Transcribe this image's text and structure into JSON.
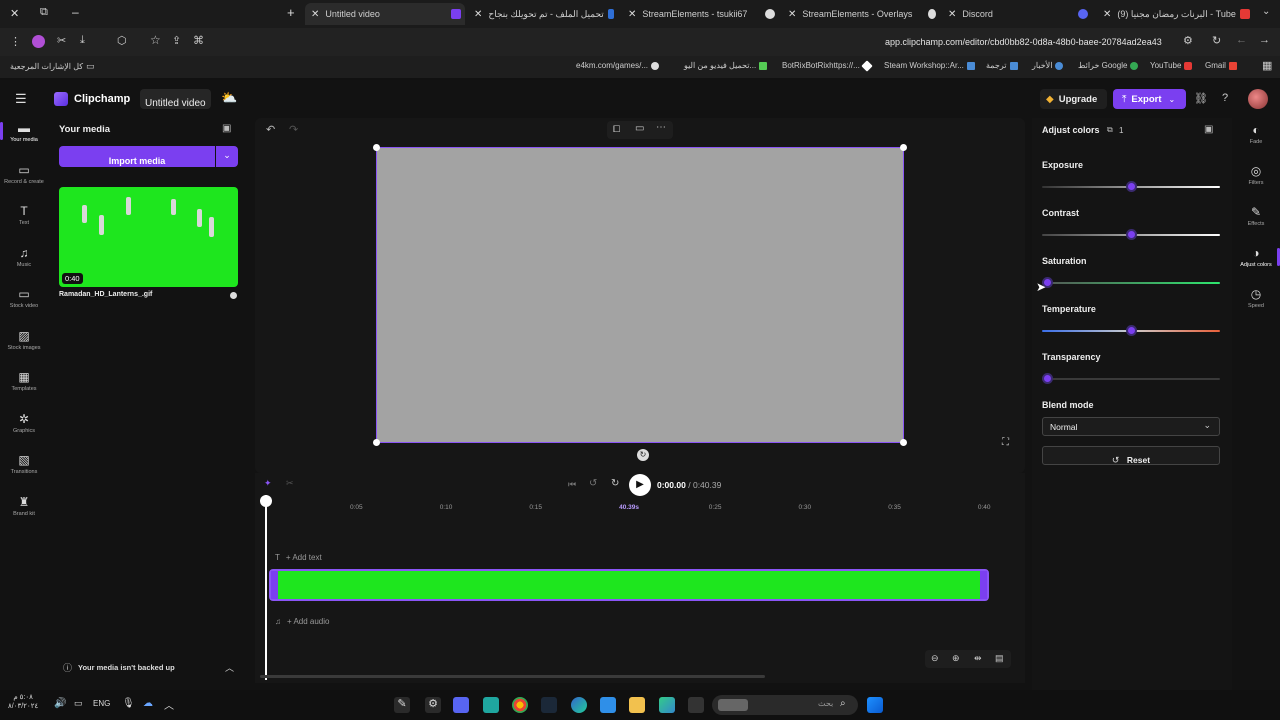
{
  "browser": {
    "tabs": [
      {
        "label": "Untitled video",
        "active": true
      },
      {
        "label": "تحميل الملف - تم تحويلك بنجاح"
      },
      {
        "label": "StreamElements - tsukii67"
      },
      {
        "label": "StreamElements - Overlays"
      },
      {
        "label": "Discord"
      },
      {
        "label": "(9) البرنات رمضان مجنيا - Tube"
      }
    ],
    "url": "app.clipchamp.com/editor/cbd0bb82-0d8a-48b0-baee-20784ad2ea43",
    "bookmarks": [
      "كل الإشارات المرجعية",
      "e4km.com/games/...",
      "تحميل فيديو من اليو...",
      "BotRixBotRixhttps://...",
      "Steam Workshop::Ar...",
      "ترجمة",
      "الأخبار",
      "خرائط Google",
      "YouTube",
      "Gmail"
    ]
  },
  "app": {
    "brand": "Clipchamp",
    "project_title": "Untitled video",
    "upgrade_label": "Upgrade",
    "export_label": "Export",
    "nav": [
      {
        "label": "Your media",
        "icon": "folder-icon"
      },
      {
        "label": "Record & create",
        "icon": "camera-icon"
      },
      {
        "label": "Text",
        "icon": "text-icon"
      },
      {
        "label": "Music",
        "icon": "music-icon"
      },
      {
        "label": "Stock video",
        "icon": "film-icon"
      },
      {
        "label": "Stock images",
        "icon": "image-icon"
      },
      {
        "label": "Templates",
        "icon": "templates-icon"
      },
      {
        "label": "Graphics",
        "icon": "shapes-icon"
      },
      {
        "label": "Transitions",
        "icon": "transitions-icon"
      },
      {
        "label": "Brand kit",
        "icon": "brand-icon"
      }
    ],
    "media_panel": {
      "title": "Your media",
      "import_label": "Import media",
      "item": {
        "duration": "0:40",
        "filename": "Ramadan_HD_Lanterns_.gif"
      },
      "backup_notice": "Your media isn't backed up"
    },
    "playback": {
      "current": "0:00.00",
      "separator": "/",
      "total": "0:40.39"
    },
    "timeline": {
      "ticks": [
        "0:05",
        "0:10",
        "0:15",
        "40.39s",
        "0:25",
        "0:30",
        "0:35",
        "0:40"
      ],
      "add_text": "+ Add text",
      "add_audio": "+ Add audio"
    },
    "adjust": {
      "title": "Adjust colors",
      "count": "1",
      "exposure": {
        "label": "Exposure",
        "value": 0.5
      },
      "contrast": {
        "label": "Contrast",
        "value": 0.5
      },
      "saturation": {
        "label": "Saturation",
        "value": 0.0
      },
      "temperature": {
        "label": "Temperature",
        "value": 0.5
      },
      "transparency": {
        "label": "Transparency",
        "value": 0.0
      },
      "blend_label": "Blend mode",
      "blend_value": "Normal",
      "reset_label": "Reset"
    },
    "right_nav": [
      {
        "label": "Fade",
        "icon": "fade-icon"
      },
      {
        "label": "Filters",
        "icon": "filters-icon"
      },
      {
        "label": "Effects",
        "icon": "effects-icon"
      },
      {
        "label": "Adjust colors",
        "icon": "adjust-icon"
      },
      {
        "label": "Speed",
        "icon": "speed-icon"
      }
    ]
  },
  "taskbar": {
    "lang": "ENG",
    "time": "٥:٠٨ م",
    "date": "٨/٠٣/٢٠٢٤",
    "search_placeholder": "بحث"
  },
  "colors": {
    "accent": "#7b3ff0",
    "green": "#1ee61e",
    "preview_bg": "#a3a3a3"
  }
}
